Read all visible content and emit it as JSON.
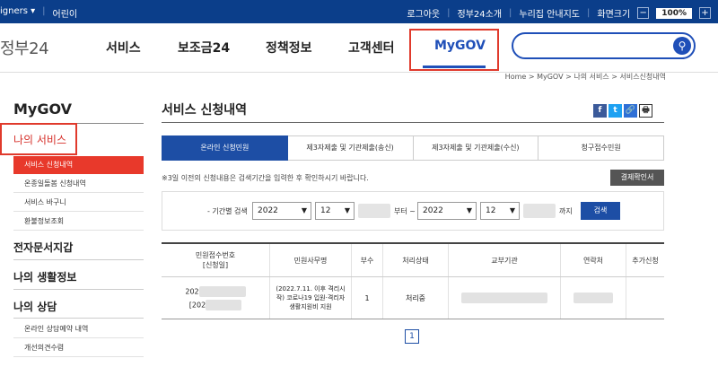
{
  "topbar": {
    "left": [
      "igners ▾",
      "어린이"
    ],
    "right": [
      "로그아웃",
      "정부24소개",
      "누리집 안내지도",
      "화면크기"
    ],
    "zoom_minus": "−",
    "zoom_value": "100%",
    "zoom_plus": "+"
  },
  "gnb": {
    "logo": "정부24",
    "menus": [
      "서비스",
      "보조금24",
      "정책정보",
      "고객센터",
      "MyGOV"
    ]
  },
  "breadcrumb": "Home > MyGOV > 나의 서비스 > 서비스신청내역",
  "sidebar": {
    "title": "MyGOV",
    "section1": "나의 서비스",
    "sub1": [
      "서비스 신청내역",
      "온종일돌봄 신청내역",
      "서비스 바구니",
      "환불정보조회"
    ],
    "section2": "전자문서지갑",
    "section3": "나의 생활정보",
    "section4": "나의 상담",
    "sub4": [
      "온라인 상담예약 내역",
      "개선의견수렴"
    ]
  },
  "content": {
    "title": "서비스 신청내역",
    "share": [
      "f",
      "t",
      "🔗",
      "🖶"
    ],
    "tabs": [
      "온라인 신청민원",
      "제3자제출 및 기관제출(송신)",
      "제3자제출 및 기관제출(수신)",
      "청구접수민원"
    ],
    "notice": "※3일 이전의 신청내용은 검색기간을 입력한 후 확인하시기 바랍니다.",
    "pay_button": "결제확인서",
    "filter": {
      "label": "- 기간별 검색",
      "from_year": "2022",
      "from_month": "12",
      "from_suffix": "부터 ~",
      "to_year": "2022",
      "to_month": "12",
      "to_suffix": "까지",
      "search": "검색"
    },
    "table": {
      "headers": [
        "민원접수번호\n[신청일]",
        "민원사무명",
        "부수",
        "처리상태",
        "교부기관",
        "연락처",
        "추가신청"
      ],
      "row": {
        "id_prefix": "202",
        "date_prefix": "[202",
        "service": "(2022.7.11. 이후 격리시작) 코로나19 입원·격리자 생활지원비 지원",
        "count": "1",
        "status": "처리중"
      }
    },
    "page": "1"
  }
}
